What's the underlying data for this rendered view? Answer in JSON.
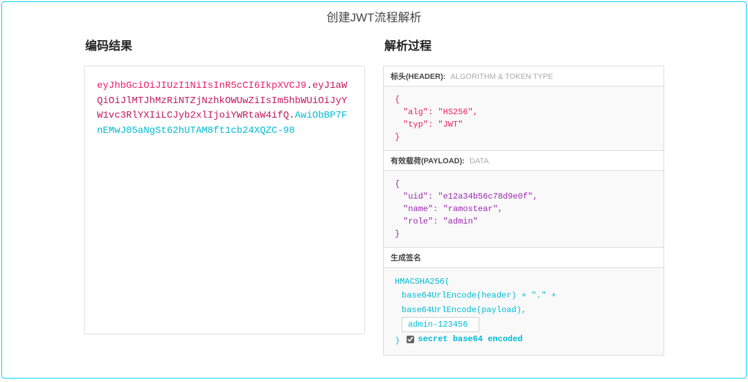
{
  "page_title": "创建JWT流程解析",
  "left": {
    "heading": "编码结果",
    "header_segment": "eyJhbGciOiJIUzI1NiIsInR5cCI6IkpXVCJ9",
    "payload_segment": "eyJ1aWQiOiJlMTJhMzRiNTZjNzhkOWUwZiIsIm5hbWUiOiJyYW1vc3RlYXIiLCJyb2xlIjoiYWRtaW4ifQ",
    "signature_segment": "AwiObBP7FnEMwJ05aNgSt62hUTAM8ft1cb24XQZC-98",
    "dot": "."
  },
  "right": {
    "heading": "解析过程",
    "header_section": {
      "label_primary": "标头(HEADER):",
      "label_secondary": "ALGORITHM & TOKEN TYPE",
      "open_brace": "{",
      "close_brace": "}",
      "alg_line": "\"alg\": \"HS256\",",
      "typ_line": "\"typ\": \"JWT\""
    },
    "payload_section": {
      "label_primary": "有效载荷(PAYLOAD):",
      "label_secondary": "DATA",
      "open_brace": "{",
      "close_brace": "}",
      "uid_line": "\"uid\": \"e12a34b56c78d9e0f\",",
      "name_line": "\"name\": \"ramostear\",",
      "role_line": "\"role\": \"admin\""
    },
    "signature_section": {
      "label_primary": "生成签名",
      "line1": "HMACSHA256(",
      "line2": "base64UrlEncode(header) + \".\" +",
      "line3": "base64UrlEncode(payload),",
      "secret_value": "admin-123456",
      "close_paren": ")",
      "checkbox_label": "secret base64 encoded"
    }
  }
}
